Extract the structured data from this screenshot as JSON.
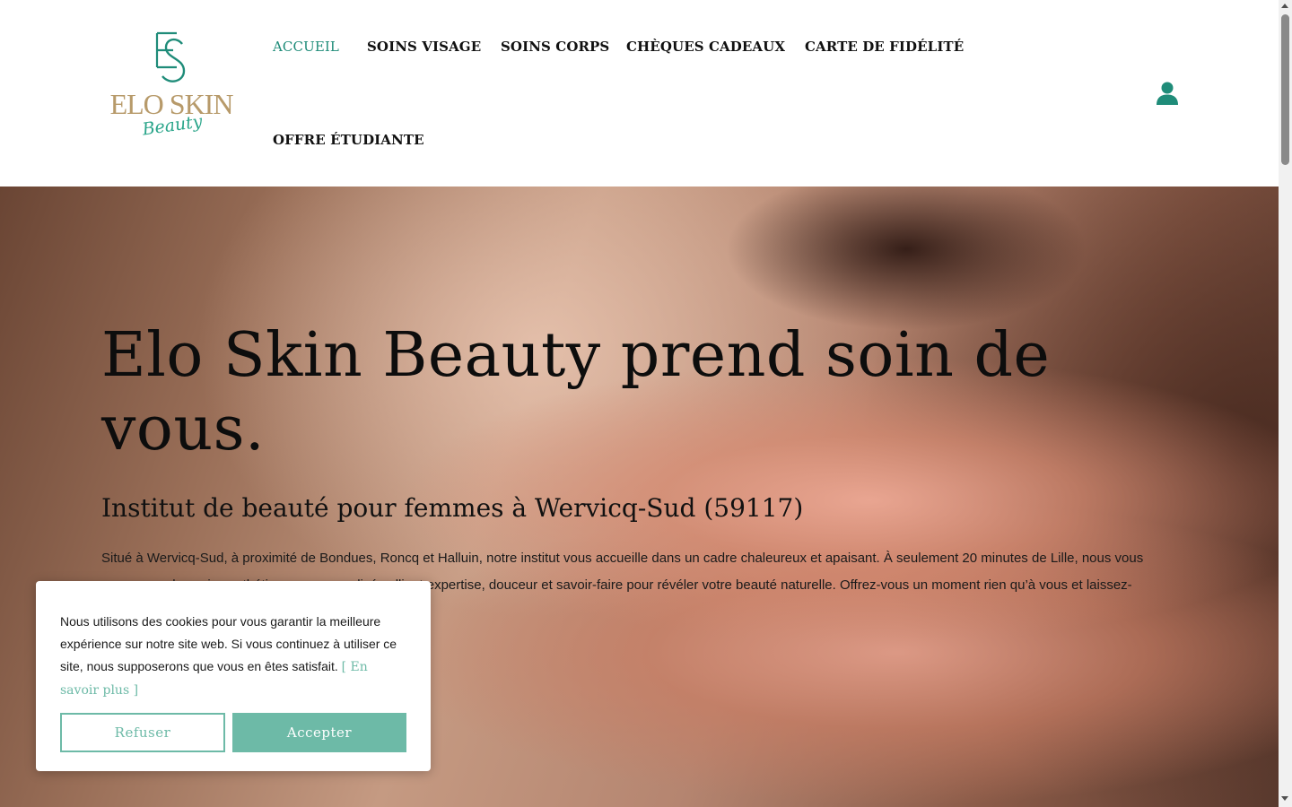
{
  "brand": {
    "logo_mark": "ES",
    "logo_word": "ELO SKIN",
    "logo_script": "Beauty",
    "colors": {
      "accent": "#1f8c79",
      "gold": "#b79a6a",
      "button": "#6dbaa7"
    }
  },
  "nav": {
    "items": [
      {
        "label": "ACCUEIL",
        "active": true
      },
      {
        "label": "SOINS VISAGE",
        "active": false
      },
      {
        "label": "SOINS CORPS",
        "active": false
      },
      {
        "label": "CHÈQUES CADEAUX",
        "active": false
      },
      {
        "label": "CARTE DE FIDÉLITÉ",
        "active": false
      },
      {
        "label": "OFFRE ÉTUDIANTE",
        "active": false
      }
    ],
    "account_icon": "user-icon"
  },
  "hero": {
    "title": "Elo Skin Beauty prend soin de vous.",
    "subtitle": "Institut de beauté pour femmes à Wervicq-Sud (59117)",
    "text": "Situé à Wervicq-Sud, à proximité de Bondues, Roncq et Halluin, notre institut vous accueille dans un cadre chaleureux et apaisant. À seulement 20 minutes de Lille, nous vous proposons des soins esthétiques personnalisés alliant expertise, douceur et savoir-faire pour révéler votre beauté naturelle. Offrez-vous un moment rien qu’à vous et laissez-"
  },
  "cookie": {
    "text": "Nous utilisons des cookies pour vous garantir la meilleure expérience sur notre site web. Si vous continuez à utiliser ce site, nous supposerons que vous en êtes satisfait.",
    "link": "[ En savoir plus ]",
    "refuse_label": "Refuser",
    "accept_label": "Accepter"
  }
}
